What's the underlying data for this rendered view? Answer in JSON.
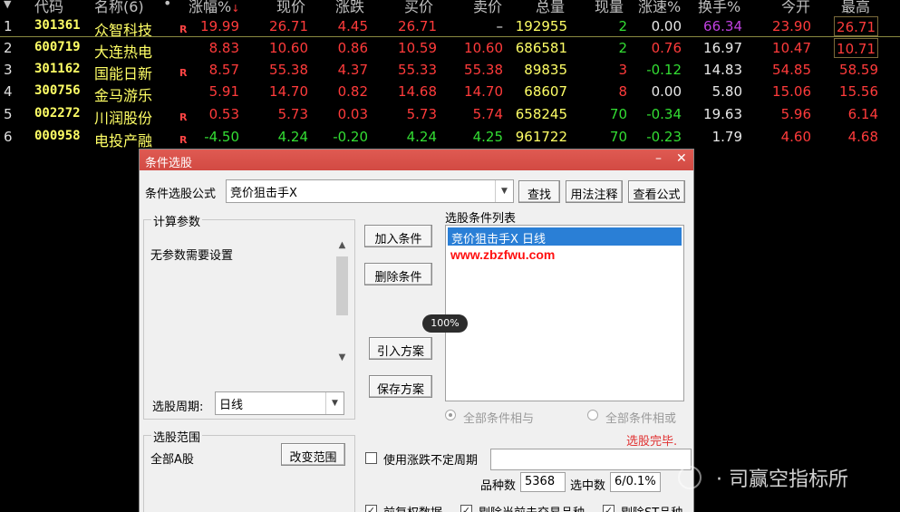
{
  "table": {
    "headers": {
      "code": "代码",
      "name": "名称(6)",
      "dot": "•",
      "change_pct": "涨幅%",
      "price": "现价",
      "change": "涨跌",
      "bid": "买价",
      "ask": "卖价",
      "volume": "总量",
      "cur_vol": "现量",
      "speed": "涨速%",
      "turnover": "换手%",
      "open": "今开",
      "high": "最高"
    },
    "header_arrow": "▼",
    "rows": [
      {
        "idx": "1",
        "code": "301361",
        "name": "众智科技",
        "r": "R",
        "change_pct": "19.99",
        "price": "26.71",
        "change": "4.45",
        "bid": "26.71",
        "ask": "–",
        "volume": "192955",
        "cur_vol": "2",
        "speed": "0.00",
        "turnover": "66.34",
        "open": "23.90",
        "high": "26.71"
      },
      {
        "idx": "2",
        "code": "600719",
        "name": "大连热电",
        "r": "",
        "change_pct": "8.83",
        "price": "10.60",
        "change": "0.86",
        "bid": "10.59",
        "ask": "10.60",
        "volume": "686581",
        "cur_vol": "2",
        "speed": "0.76",
        "turnover": "16.97",
        "open": "10.47",
        "high": "10.71"
      },
      {
        "idx": "3",
        "code": "301162",
        "name": "国能日新",
        "r": "R",
        "change_pct": "8.57",
        "price": "55.38",
        "change": "4.37",
        "bid": "55.33",
        "ask": "55.38",
        "volume": "89835",
        "cur_vol": "3",
        "speed": "-0.12",
        "turnover": "14.83",
        "open": "54.85",
        "high": "58.59"
      },
      {
        "idx": "4",
        "code": "300756",
        "name": "金马游乐",
        "r": "",
        "change_pct": "5.91",
        "price": "14.70",
        "change": "0.82",
        "bid": "14.68",
        "ask": "14.70",
        "volume": "68607",
        "cur_vol": "8",
        "speed": "0.00",
        "turnover": "5.80",
        "open": "15.06",
        "high": "15.56"
      },
      {
        "idx": "5",
        "code": "002272",
        "name": "川润股份",
        "r": "R",
        "change_pct": "0.53",
        "price": "5.73",
        "change": "0.03",
        "bid": "5.73",
        "ask": "5.74",
        "volume": "658245",
        "cur_vol": "70",
        "speed": "-0.34",
        "turnover": "19.63",
        "open": "5.96",
        "high": "6.14"
      },
      {
        "idx": "6",
        "code": "000958",
        "name": "电投产融",
        "r": "R",
        "change_pct": "-4.50",
        "price": "4.24",
        "change": "-0.20",
        "bid": "4.24",
        "ask": "4.25",
        "volume": "961722",
        "cur_vol": "70",
        "speed": "-0.23",
        "turnover": "1.79",
        "open": "4.60",
        "high": "4.68"
      }
    ]
  },
  "dialog": {
    "title": "条件选股",
    "minimize": "–",
    "close": "✕",
    "formula_label": "条件选股公式",
    "formula_value": "竞价狙击手X",
    "btn_find": "查找",
    "btn_usage": "用法注释",
    "btn_view": "查看公式",
    "params_group": "计算参数",
    "params_text": "无参数需要设置",
    "btn_add": "加入条件",
    "btn_delete": "删除条件",
    "btn_import": "引入方案",
    "btn_save": "保存方案",
    "list_label": "选股条件列表",
    "list_items": [
      "竞价狙击手X  日线"
    ],
    "period_label": "选股周期:",
    "period_value": "日线",
    "radio_and": "全部条件相与",
    "radio_or": "全部条件相或",
    "status": "选股完毕.",
    "range_group": "选股范围",
    "range_value": "全部A股",
    "btn_change_range": "改变范围",
    "chk_uncertain": "使用涨跌不定周期",
    "count_label": "品种数",
    "count_value": "5368",
    "selected_label": "选中数",
    "selected_value": "6/0.1%",
    "chk_adjusted": "前复权数据",
    "chk_exclude_untraded": "剔除当前未交易品种",
    "chk_exclude_st": "剔除ST品种"
  },
  "overlay": {
    "zoom": "100%",
    "watermark_url": "www.zbzfwu.com",
    "watermark_brand": "· 司赢空指标所"
  }
}
